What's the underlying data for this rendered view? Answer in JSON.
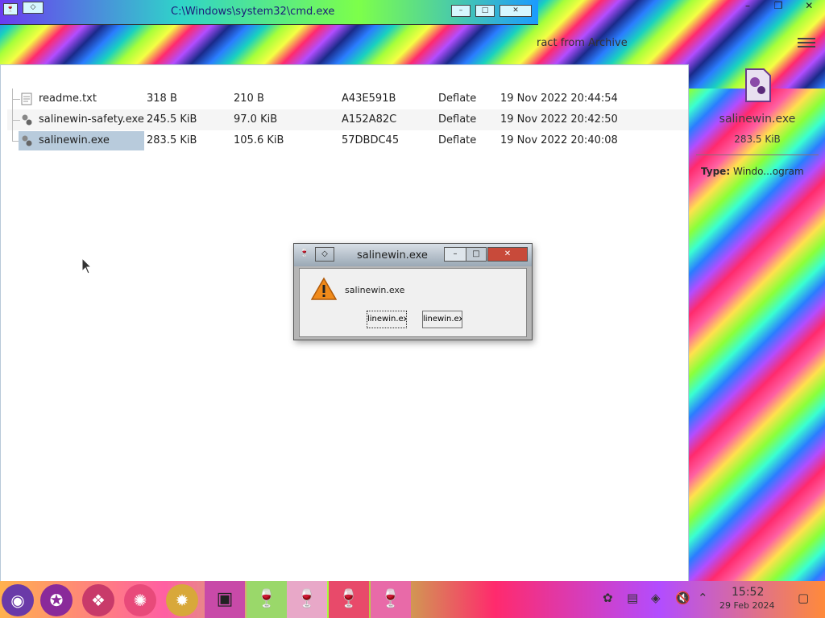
{
  "cmd_window": {
    "title": "C:\\Windows\\system32\\cmd.exe"
  },
  "archive_app": {
    "extract_label": "ract from Archive",
    "files": [
      {
        "name": "readme.txt",
        "size": "318 B",
        "compressed": "210 B",
        "crc": "A43E591B",
        "method": "Deflate",
        "modified": "19 Nov 2022 20:44:54",
        "icon": "text-file-icon"
      },
      {
        "name": "salinewin-safety.exe",
        "size": "245.5 KiB",
        "compressed": "97.0 KiB",
        "crc": "A152A82C",
        "method": "Deflate",
        "modified": "19 Nov 2022 20:42:50",
        "icon": "executable-icon"
      },
      {
        "name": "salinewin.exe",
        "size": "283.5 KiB",
        "compressed": "105.6 KiB",
        "crc": "57DBDC45",
        "method": "Deflate",
        "modified": "19 Nov 2022 20:40:08",
        "icon": "executable-icon",
        "selected": true
      }
    ],
    "details": {
      "name": "salinewin.exe",
      "size": "283.5 KiB",
      "type_label": "Type:",
      "type_value": "Windo...ogram"
    }
  },
  "dialog": {
    "title": "salinewin.exe",
    "message": "salinewin.exe",
    "button1": "linewin.exe",
    "button2": "linewin.exe"
  },
  "taskbar": {
    "time": "15:52",
    "date": "29 Feb 2024"
  }
}
